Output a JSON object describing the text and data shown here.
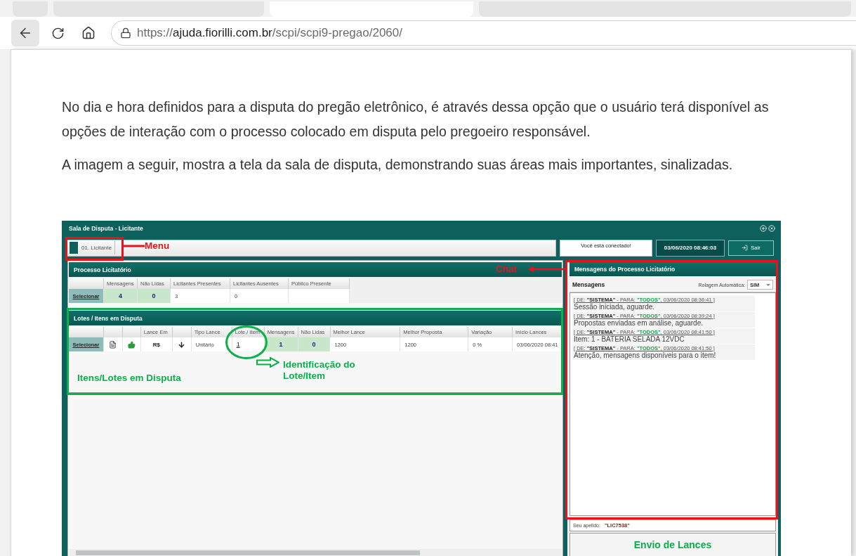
{
  "browser": {
    "active_tab": true,
    "url": {
      "scheme": "https://",
      "host": "ajuda.fiorilli.com.br",
      "path": "/scpi/scpi9-pregao/2060/"
    }
  },
  "article": {
    "paragraphs": [
      "No dia e hora definidos para a disputa do pregão eletrônico, é através dessa opção que o usuário terá disponível as opções de interação com o processo colocado em disputa pelo pregoeiro responsável.",
      "A imagem a seguir, mostra a tela da sala de disputa, demonstrando suas áreas mais importantes, sinalizadas."
    ]
  },
  "figure": {
    "window_title": "Sala de Disputa - Licitante",
    "menu_button": "01. Licitante",
    "status": "Você está conectado!",
    "datetime": "03/06/2020 08:46:03",
    "exit_button": "Sair",
    "process": {
      "title": "Processo Licitatório",
      "columns": [
        {
          "kind": "blank"
        },
        {
          "kind": "label",
          "label": "Mensagens"
        },
        {
          "kind": "label",
          "label": "Não Lidas"
        },
        {
          "kind": "label",
          "label": "Licitantes Presentes"
        },
        {
          "kind": "label",
          "label": "Licitantes Ausentes"
        },
        {
          "kind": "label",
          "label": "Público Presente"
        }
      ],
      "row": [
        {
          "kind": "link",
          "text": "Selecionar"
        },
        {
          "kind": "count",
          "text": "4"
        },
        {
          "kind": "count",
          "text": "0"
        },
        {
          "kind": "text",
          "text": "3"
        },
        {
          "kind": "text",
          "text": "0"
        },
        {
          "kind": "empty"
        }
      ]
    },
    "lots": {
      "title": "Lotes / Itens em Disputa",
      "columns": [
        {
          "kind": "blank"
        },
        {
          "kind": "blank"
        },
        {
          "kind": "blank"
        },
        {
          "kind": "label",
          "label": "Lance Em"
        },
        {
          "kind": "blank"
        },
        {
          "kind": "label",
          "label": "Tipo Lance"
        },
        {
          "kind": "label",
          "label": "Lote / Item"
        },
        {
          "kind": "label",
          "label": "Mensagens"
        },
        {
          "kind": "label",
          "label": "Não Lidas"
        },
        {
          "kind": "label",
          "label": "Melhor Lance"
        },
        {
          "kind": "label",
          "label": "Melhor Proposta"
        },
        {
          "kind": "label",
          "label": "Variação"
        },
        {
          "kind": "label",
          "label": "Início Lances"
        }
      ],
      "row": [
        {
          "kind": "link",
          "text": "Selecionar"
        },
        {
          "kind": "icon"
        },
        {
          "kind": "icon"
        },
        {
          "kind": "strong",
          "text": "R$"
        },
        {
          "kind": "icon"
        },
        {
          "kind": "text",
          "text": "Unitário"
        },
        {
          "kind": "underline",
          "text": "1"
        },
        {
          "kind": "count",
          "text": "1"
        },
        {
          "kind": "count",
          "text": "0"
        },
        {
          "kind": "text",
          "text": "1200"
        },
        {
          "kind": "text",
          "text": "1200"
        },
        {
          "kind": "text",
          "text": "0 %"
        },
        {
          "kind": "text",
          "text": "03/06/2020 08:41"
        }
      ]
    },
    "chat": {
      "title": "Mensagens do Processo Licitatório",
      "subtitle": "Mensagens",
      "autoscroll_label": "Rolagem Automática:",
      "autoscroll_value": "SIM",
      "messages": [
        {
          "open": "[ DE:",
          "sender": "\"SISTEMA\"",
          "mid": "- PARA:",
          "recipient": "\"TODOS\"",
          "stamp": ", 03/06/2020 08:36:41 ]",
          "text": "Sessão iniciada, aguarde."
        },
        {
          "open": "[ DE:",
          "sender": "\"SISTEMA\"",
          "mid": "- PARA:",
          "recipient": "\"TODOS\"",
          "stamp": ", 03/06/2020 08:39:24 ]",
          "text": "Propostas enviadas em análise, aguarde."
        },
        {
          "open": "[ DE:",
          "sender": "\"SISTEMA\"",
          "mid": "- PARA:",
          "recipient": "\"TODOS\"",
          "stamp": ", 03/06/2020 08:41:50 ]",
          "text": "Item: 1 - BATERIA SELADA 12VDC"
        },
        {
          "open": "[ DE:",
          "sender": "\"SISTEMA\"",
          "mid": "- PARA:",
          "recipient": "\"TODOS\"",
          "stamp": ", 03/06/2020 08:41:50 ]",
          "text": "Atenção, mensagens disponíveis para o item!"
        }
      ]
    },
    "nickname_label": "Seu apelido:",
    "nickname": "\"LIC7538\"",
    "bids_title": "Envio de Lances",
    "annotations": [
      {
        "kind": "box",
        "color": "#e8141b"
      },
      {
        "kind": "arrow",
        "color": "#e8141b"
      },
      {
        "kind": "label",
        "text": "Menu",
        "color": "#e8141b"
      },
      {
        "kind": "label",
        "text": "Chat",
        "color": "#e8141b"
      },
      {
        "kind": "arrow",
        "color": "#e8141b"
      },
      {
        "kind": "box",
        "color": "#e8141b"
      },
      {
        "kind": "box",
        "color": "#0bb04a"
      },
      {
        "kind": "circle",
        "color": "#0bb04a"
      },
      {
        "kind": "hollow-arrow",
        "color": "#0bb04a"
      },
      {
        "kind": "label",
        "text": "Identificação do Lote/Item",
        "color": "#0bb04a"
      },
      {
        "kind": "label",
        "text": "Itens/Lotes em Disputa",
        "color": "#0bb04a"
      }
    ]
  }
}
